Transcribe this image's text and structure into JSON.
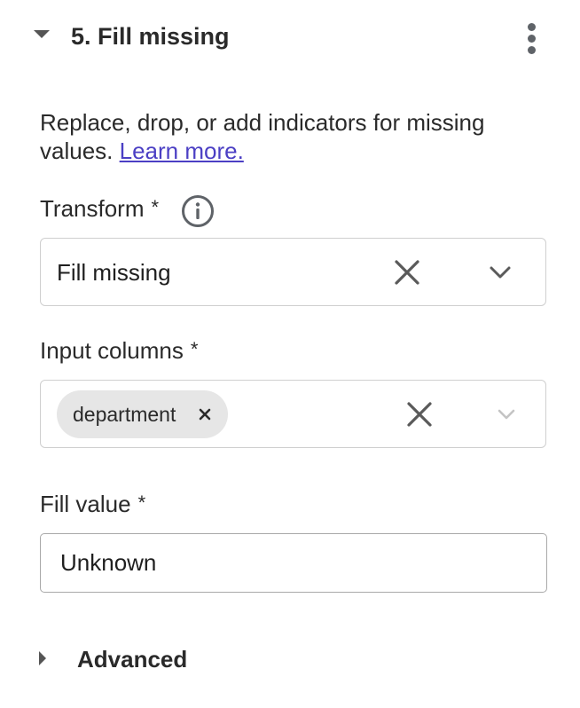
{
  "step": {
    "title": "5. Fill missing",
    "collapse_icon": "caret-down-icon",
    "menu_icon": "more-vertical-icon"
  },
  "description": {
    "text": "Replace, drop, or add indicators for missing values.",
    "link_label": "Learn more."
  },
  "transform": {
    "label": "Transform",
    "required_mark": "*",
    "info_icon": "info-icon",
    "selected_value": "Fill missing",
    "clear_icon": "close-icon",
    "dropdown_icon": "chevron-down-icon"
  },
  "input_columns": {
    "label": "Input columns",
    "required_mark": "*",
    "chips": [
      {
        "label": "department",
        "remove_icon": "close-icon"
      }
    ],
    "clear_icon": "close-icon",
    "dropdown_icon": "chevron-down-icon"
  },
  "fill_value": {
    "label": "Fill value",
    "required_mark": "*",
    "value": "Unknown"
  },
  "advanced": {
    "label": "Advanced",
    "expand_icon": "caret-right-icon"
  },
  "colors": {
    "link": "#4b3fc4",
    "chip_background": "#e6e6e6",
    "border": "#cfcfcf",
    "icon": "#5f6368"
  }
}
